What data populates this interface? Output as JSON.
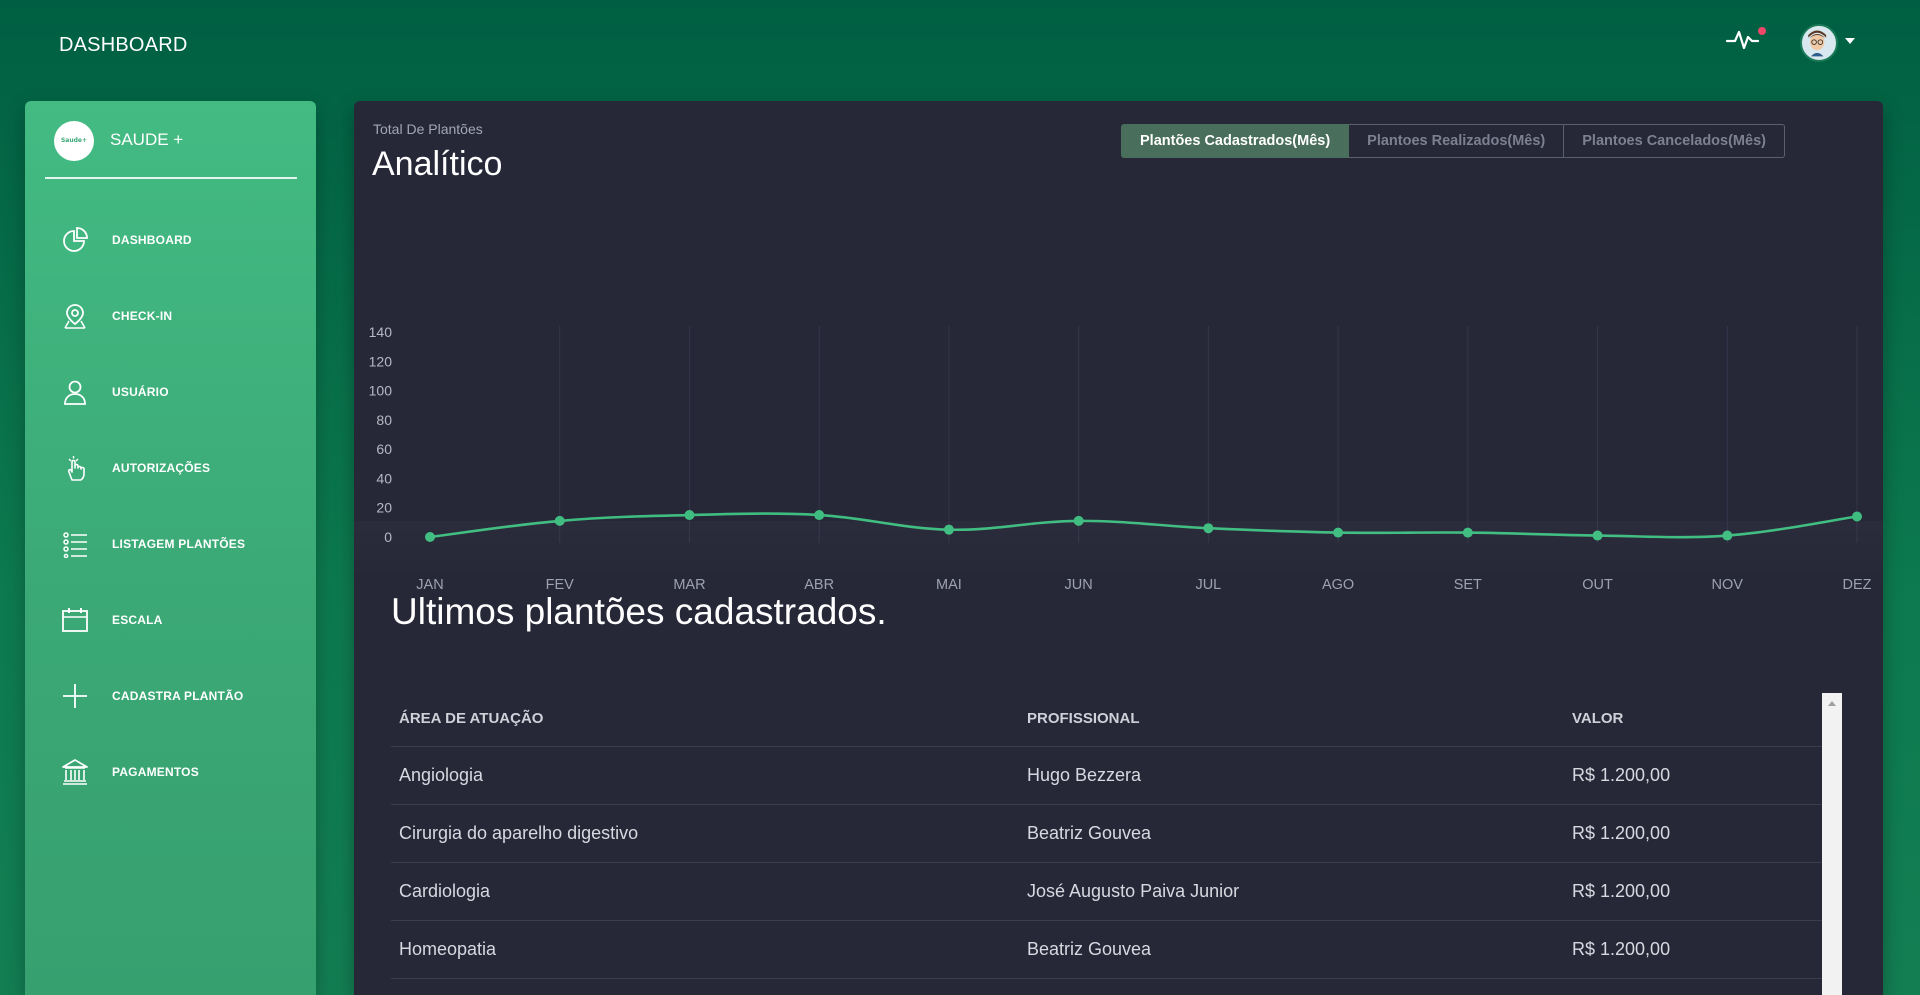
{
  "header": {
    "title": "DASHBOARD"
  },
  "brand": {
    "logo_text": "Saude+",
    "name": "SAUDE +"
  },
  "sidebar": {
    "items": [
      {
        "label": "DASHBOARD",
        "icon": "pie-chart-icon"
      },
      {
        "label": "CHECK-IN",
        "icon": "location-pin-icon"
      },
      {
        "label": "USUÁRIO",
        "icon": "user-icon"
      },
      {
        "label": "AUTORIZAÇÕES",
        "icon": "hand-pointer-icon"
      },
      {
        "label": "LISTAGEM PLANTÕES",
        "icon": "list-icon"
      },
      {
        "label": "ESCALA",
        "icon": "calendar-icon"
      },
      {
        "label": "CADASTRA PLANTÃO",
        "icon": "plus-icon"
      },
      {
        "label": "PAGAMENTOS",
        "icon": "bank-icon"
      }
    ]
  },
  "panel": {
    "subtitle": "Total De Plantões",
    "title": "Analítico",
    "tabs": [
      {
        "label": "Plantões Cadastrados(Mês)",
        "active": true
      },
      {
        "label": "Plantoes Realizados(Mês)",
        "active": false
      },
      {
        "label": "Plantoes Cancelados(Mês)",
        "active": false
      }
    ]
  },
  "chart_data": {
    "type": "line",
    "categories": [
      "JAN",
      "FEV",
      "MAR",
      "ABR",
      "MAI",
      "JUN",
      "JUL",
      "AGO",
      "SET",
      "OUT",
      "NOV",
      "DEZ"
    ],
    "series": [
      {
        "values": [
          0,
          11,
          15,
          15,
          5,
          11,
          6,
          3,
          3,
          1,
          1,
          14
        ]
      }
    ],
    "yticks": [
      0,
      20,
      40,
      60,
      80,
      100,
      120,
      140
    ],
    "ylim": [
      0,
      140
    ],
    "grid": "vertical",
    "color": "#3fbd80"
  },
  "latest": {
    "title": "Ultimos plantões cadastrados.",
    "columns": [
      "ÁREA DE ATUAÇÃO",
      "PROFISSIONAL",
      "VALOR"
    ],
    "rows": [
      [
        "Angiologia",
        "Hugo Bezzera",
        "R$ 1.200,00"
      ],
      [
        "Cirurgia do aparelho digestivo",
        "Beatriz Gouvea",
        "R$ 1.200,00"
      ],
      [
        "Cardiologia",
        "José Augusto Paiva Junior",
        "R$ 1.200,00"
      ],
      [
        "Homeopatia",
        "Beatriz Gouvea",
        "R$ 1.200,00"
      ]
    ]
  },
  "colors": {
    "background": "#006847",
    "sidebar": "#40b57e",
    "panel": "#262838",
    "accent": "#3fbd80",
    "notification": "#f0476b"
  }
}
